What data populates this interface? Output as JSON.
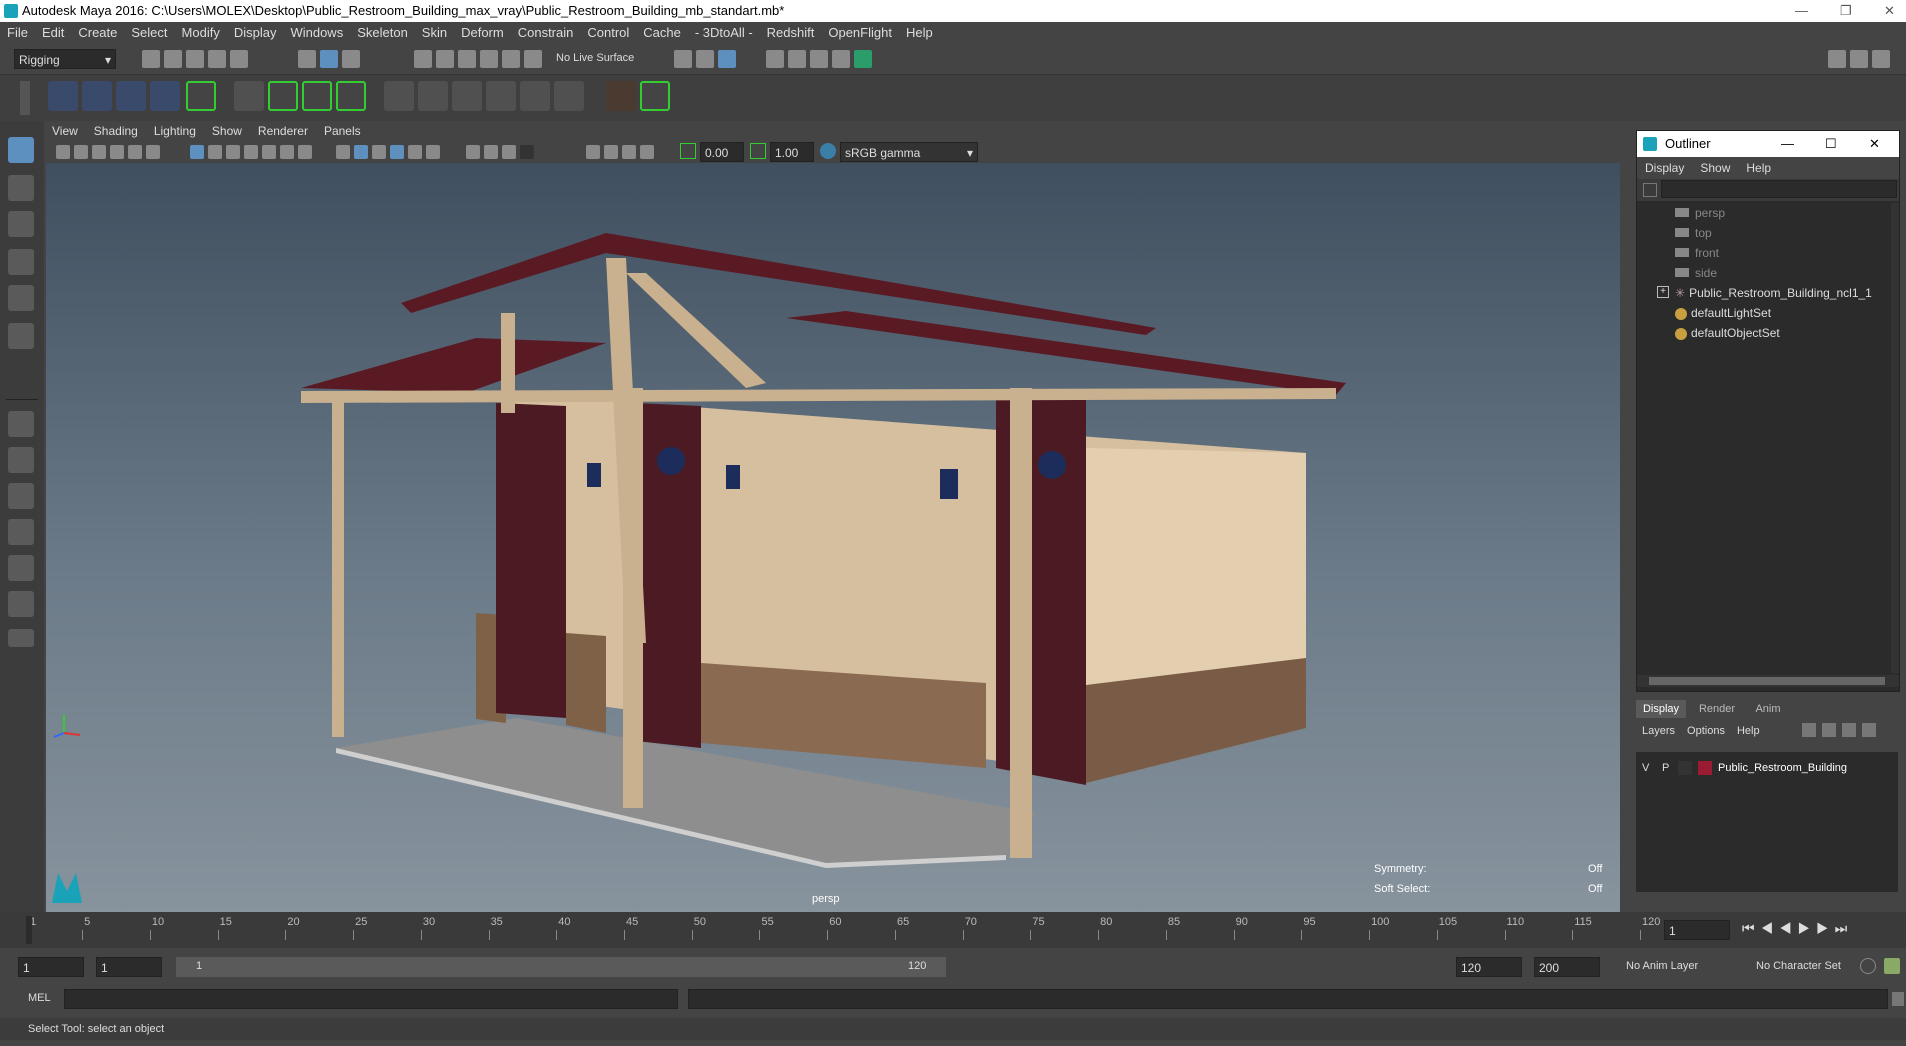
{
  "window": {
    "title": "Autodesk Maya 2016: C:\\Users\\MOLEX\\Desktop\\Public_Restroom_Building_max_vray\\Public_Restroom_Building_mb_standart.mb*"
  },
  "menus": [
    "File",
    "Edit",
    "Create",
    "Select",
    "Modify",
    "Display",
    "Windows",
    "Skeleton",
    "Skin",
    "Deform",
    "Constrain",
    "Control",
    "Cache",
    "- 3DtoAll -",
    "Redshift",
    "OpenFlight",
    "Help"
  ],
  "statusline": {
    "menuset": "Rigging",
    "live_surface": "No Live Surface"
  },
  "viewport": {
    "menus": [
      "View",
      "Shading",
      "Lighting",
      "Show",
      "Renderer",
      "Panels"
    ],
    "exposure": "0.00",
    "gamma": "1.00",
    "colorspace": "sRGB gamma",
    "camera_label": "persp",
    "symmetry_label": "Symmetry:",
    "symmetry_value": "Off",
    "softselect_label": "Soft Select:",
    "softselect_value": "Off"
  },
  "outliner": {
    "title": "Outliner",
    "menus": [
      "Display",
      "Show",
      "Help"
    ],
    "items": [
      {
        "label": "persp",
        "icon": "camera-icon",
        "dim": true
      },
      {
        "label": "top",
        "icon": "camera-icon",
        "dim": true
      },
      {
        "label": "front",
        "icon": "camera-icon",
        "dim": true
      },
      {
        "label": "side",
        "icon": "camera-icon",
        "dim": true
      },
      {
        "label": "Public_Restroom_Building_ncl1_1",
        "icon": "group-icon",
        "dim": false
      },
      {
        "label": "defaultLightSet",
        "icon": "set-icon",
        "dim": false
      },
      {
        "label": "defaultObjectSet",
        "icon": "set-icon",
        "dim": false
      }
    ]
  },
  "layers": {
    "tabs": [
      "Display",
      "Render",
      "Anim"
    ],
    "menus": [
      "Layers",
      "Options",
      "Help"
    ],
    "row": {
      "v": "V",
      "p": "P",
      "name": "Public_Restroom_Building",
      "color": "#9b1b30"
    }
  },
  "timeline": {
    "ticks": [
      "1",
      "5",
      "10",
      "15",
      "20",
      "25",
      "30",
      "35",
      "40",
      "45",
      "50",
      "55",
      "60",
      "65",
      "70",
      "75",
      "80",
      "85",
      "90",
      "95",
      "100",
      "105",
      "110",
      "115",
      "120"
    ],
    "current_frame": "1"
  },
  "range": {
    "start": "1",
    "anim_start": "1",
    "slider_start": "1",
    "slider_end": "120",
    "end": "120",
    "anim_end": "200",
    "anim_layer": "No Anim Layer",
    "char_set": "No Character Set"
  },
  "cmd": {
    "label": "MEL"
  },
  "help": {
    "text": "Select Tool: select an object"
  }
}
